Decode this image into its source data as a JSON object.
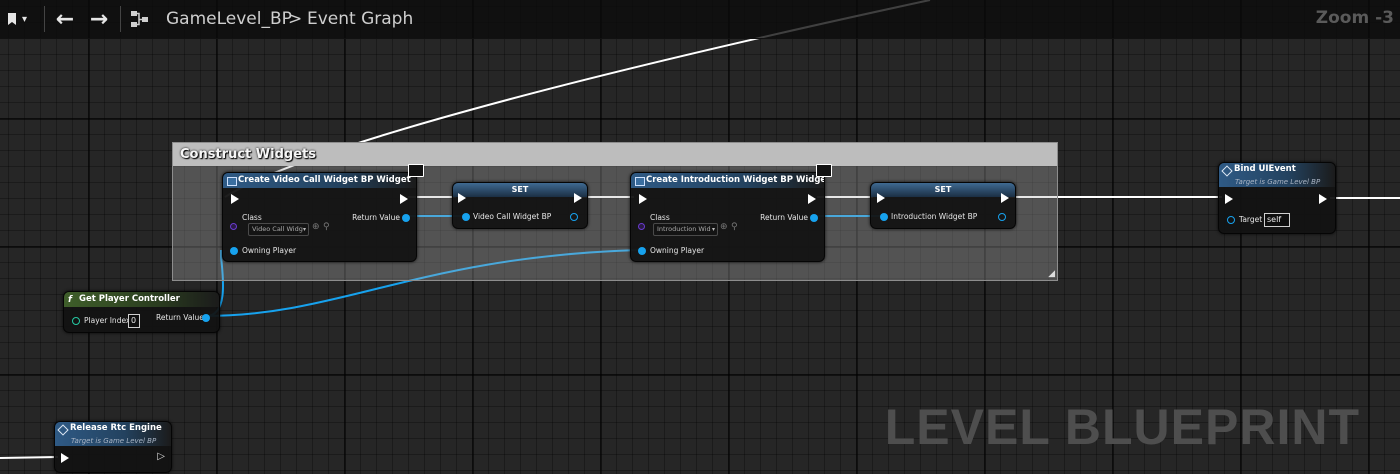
{
  "toolbar": {
    "bookmark_icon": "bookmark-icon",
    "back_icon": "arrow-left-icon",
    "forward_icon": "arrow-right-icon",
    "graph_icon": "graph-icon",
    "breadcrumb_level": "GameLevel_BP",
    "breadcrumb_separator": ">",
    "breadcrumb_graph": "Event Graph",
    "zoom": "Zoom -3"
  },
  "comment": {
    "title": "Construct Widgets"
  },
  "nodes": {
    "create_video": {
      "title": "Create Video Call Widget BP Widget",
      "class_label": "Class",
      "class_value": "Video Call Widg",
      "return_label": "Return Value",
      "owning_label": "Owning Player"
    },
    "set_video": {
      "title": "SET",
      "pin_label": "Video Call Widget BP"
    },
    "create_intro": {
      "title": "Create Introduction Widget BP Widget",
      "class_label": "Class",
      "class_value": "Introduction Wid",
      "return_label": "Return Value",
      "owning_label": "Owning Player"
    },
    "set_intro": {
      "title": "SET",
      "pin_label": "Introduction Widget BP"
    },
    "bind_ui": {
      "title": "Bind UIEvent",
      "subtitle": "Target is Game Level BP",
      "target_label": "Target",
      "target_value": "self"
    },
    "get_pc": {
      "title": "Get Player Controller",
      "index_label": "Player Index",
      "index_value": "0",
      "return_label": "Return Value"
    },
    "release_rtc": {
      "title": "Release Rtc Engine",
      "subtitle": "Target is Game Level BP"
    }
  },
  "watermark": "LEVEL BLUEPRINT",
  "colors": {
    "object_pin": "#17a2ee",
    "exec_wire": "#ffffff",
    "node_header": "#2f5a85"
  }
}
